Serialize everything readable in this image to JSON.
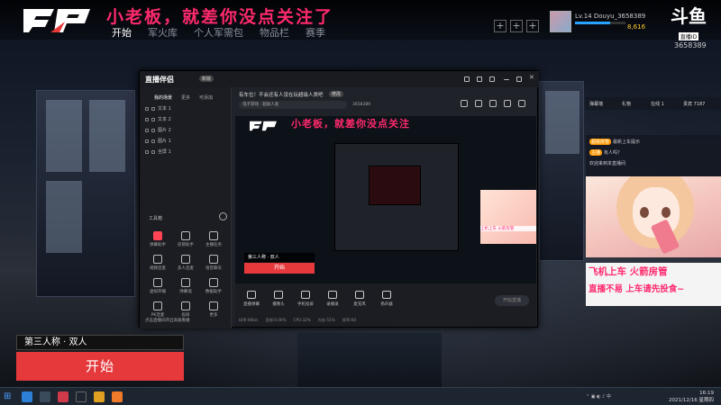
{
  "hud": {
    "banner": "小老板，就差你没点关注了",
    "nav": [
      "开始",
      "军火库",
      "个人军需包",
      "物品栏",
      "赛季"
    ],
    "profile": {
      "level": "Lv.14",
      "name": "Douyu_3658389",
      "coins": "8,616"
    },
    "douyu_logo": "斗鱼",
    "douyu_sub": "直播ID",
    "room_id": "3658389",
    "hud_buttons": [
      "+",
      "+",
      "+"
    ]
  },
  "app": {
    "logo": "直播伴侣",
    "badge": "新版",
    "left_tabs": [
      "我的场景",
      "更多",
      "可添加"
    ],
    "scenes": [
      "文本 1",
      "文本 2",
      "图片 2",
      "图片 1",
      "全屏 1"
    ],
    "tools_title": "工具箱",
    "tools": [
      "弹幕助手",
      "房管助手",
      "主播任务",
      "视频连麦",
      "多人连麦",
      "语音聊天",
      "虚拟开播",
      "弹幕墙",
      "数据助手",
      "PK连麦",
      "投屏",
      "更多"
    ],
    "bottom_note": "点击直播间开启高级看播",
    "room_title": "有车位！不会还有人没在玩超级人类吧",
    "room_tag": "修改",
    "room_info": "电子游戏 · 超级人类",
    "room_id": "3658389",
    "preview": {
      "banner": "小老板，就差你没点关注",
      "mode": "第三人称 · 双人",
      "start": "开始",
      "anime_text": "上机上车 火箭房管"
    },
    "controls": [
      "直播弹幕",
      "摄像头",
      "手机投屏",
      "录播录",
      "麦克风",
      "扬声器"
    ],
    "start_live": "开始直播",
    "stats": [
      "码率:0Kb/s",
      "丢帧:0.00%",
      "CPU:32%",
      "内存:51%",
      "帧率:60"
    ]
  },
  "right": {
    "tabs": [
      "弹幕墙",
      "礼物",
      "在线 1",
      "贵宾 7187"
    ],
    "messages": [
      {
        "badge": "超级房管",
        "text": "最新上车提示"
      },
      {
        "badge": "主播",
        "text": "有人吗？"
      },
      {
        "badge": "",
        "text": "欢迎来到本直播间"
      }
    ],
    "slogan_line1": "飞机上车 火箭房管",
    "slogan_line2": "直播不易 上车请先投食~"
  },
  "game": {
    "mode": "第三人称 · 双人",
    "start": "开始"
  },
  "taskbar": {
    "time": "16:19",
    "date": "2021/12/16 星期四",
    "lang": "中"
  },
  "colors": {
    "accent": "#ff2a6d",
    "start": "#e5393c",
    "taskbar": "#1d2531"
  }
}
